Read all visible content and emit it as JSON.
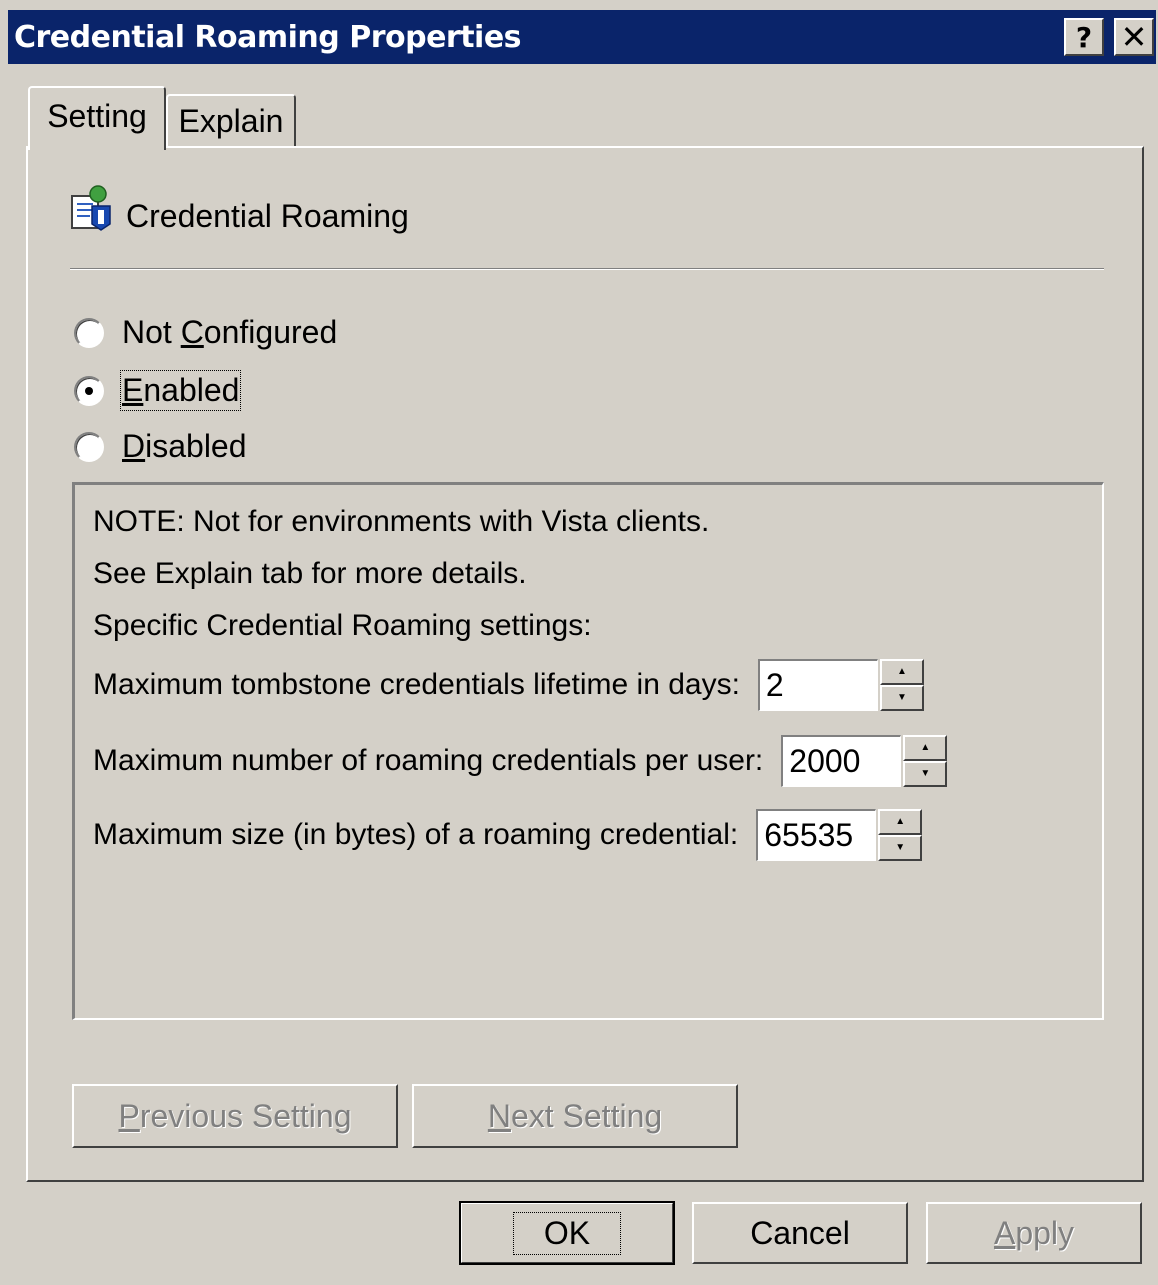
{
  "window": {
    "title": "Credential Roaming Properties",
    "help_label": "?",
    "close_label": "✕"
  },
  "tabs": [
    {
      "label": "Setting",
      "selected": true
    },
    {
      "label": "Explain",
      "selected": false
    }
  ],
  "policy": {
    "icon": "policy-setting-icon",
    "name": "Credential Roaming"
  },
  "radios": {
    "not_configured": {
      "pre": "Not ",
      "mnemonic": "C",
      "post": "onfigured",
      "checked": false
    },
    "enabled": {
      "pre": "",
      "mnemonic": "E",
      "post": "nabled",
      "checked": true
    },
    "disabled": {
      "pre": "",
      "mnemonic": "D",
      "post": "isabled",
      "checked": false
    }
  },
  "options": {
    "note": "NOTE: Not for environments with Vista clients.",
    "see_explain": "See Explain tab for more details.",
    "specific": "Specific Credential Roaming settings:",
    "spinners": [
      {
        "label": "Maximum tombstone credentials lifetime in days:",
        "value": "2"
      },
      {
        "label": "Maximum number of roaming credentials per user:",
        "value": "2000"
      },
      {
        "label": "Maximum size (in bytes) of a roaming credential:",
        "value": "65535"
      }
    ]
  },
  "nav": {
    "previous": {
      "mnemonic": "P",
      "rest": "revious Setting",
      "enabled": false
    },
    "next": {
      "mnemonic": "N",
      "rest": "ext Setting",
      "enabled": false
    }
  },
  "footer": {
    "ok": "OK",
    "cancel": "Cancel",
    "apply": {
      "mnemonic": "A",
      "rest": "pply",
      "enabled": false
    }
  },
  "colors": {
    "titlebar": "#0a246a",
    "face": "#d4d0c8",
    "disabled_text": "#808080"
  }
}
